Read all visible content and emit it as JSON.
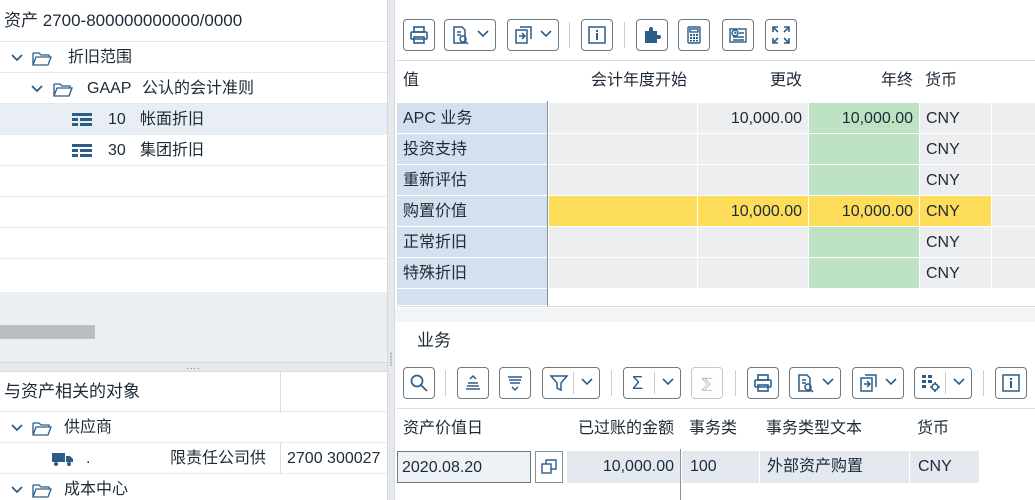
{
  "left": {
    "header": "资产 2700-800000000000/0000",
    "tree": [
      {
        "label": "折旧范围"
      },
      {
        "code": "GAAP",
        "label": "公认的会计准则"
      },
      {
        "code": "10",
        "label": "帐面折旧"
      },
      {
        "code": "30",
        "label": "集团折旧"
      }
    ],
    "related_header": "与资产相关的对象",
    "related": [
      {
        "label": "供应商"
      },
      {
        "dot": ".",
        "label_cut": "限责任公司供",
        "number": "2700 300027"
      },
      {
        "label": "成本中心"
      }
    ]
  },
  "right": {
    "upper_columns": [
      "值",
      "会计年度开始",
      "更改",
      "年终",
      "货币"
    ],
    "upper_rows": [
      {
        "label": "APC 业务",
        "fy_start": "",
        "change": "10,000.00",
        "year_end": "10,000.00",
        "currency": "CNY"
      },
      {
        "label": "投资支持",
        "fy_start": "",
        "change": "",
        "year_end": "",
        "currency": "CNY"
      },
      {
        "label": "重新评估",
        "fy_start": "",
        "change": "",
        "year_end": "",
        "currency": "CNY"
      },
      {
        "label": "购置价值",
        "fy_start": "",
        "change": "10,000.00",
        "year_end": "10,000.00",
        "currency": "CNY"
      },
      {
        "label": "正常折旧",
        "fy_start": "",
        "change": "",
        "year_end": "",
        "currency": "CNY"
      },
      {
        "label": "特殊折旧",
        "fy_start": "",
        "change": "",
        "year_end": "",
        "currency": "CNY"
      }
    ],
    "section_title": "业务",
    "lower_columns": [
      "资产价值日",
      "已过账的金额",
      "事务类",
      "事务类型文本",
      "货币"
    ],
    "lower_rows": [
      {
        "value_date": "2020.08.20",
        "amount": "10,000.00",
        "trans_type": "100",
        "trans_text": "外部资产购置",
        "currency": "CNY"
      }
    ],
    "sigma_glyph": "Σ",
    "subtotal_glyph": "⅀"
  },
  "colors": {
    "label_blue": "#d3e1ee",
    "value_gray": "#eceef0",
    "year_end_green": "#bee3c4",
    "highlight_yellow": "#fedd5b",
    "icon_blue": "#2b5d8a"
  }
}
